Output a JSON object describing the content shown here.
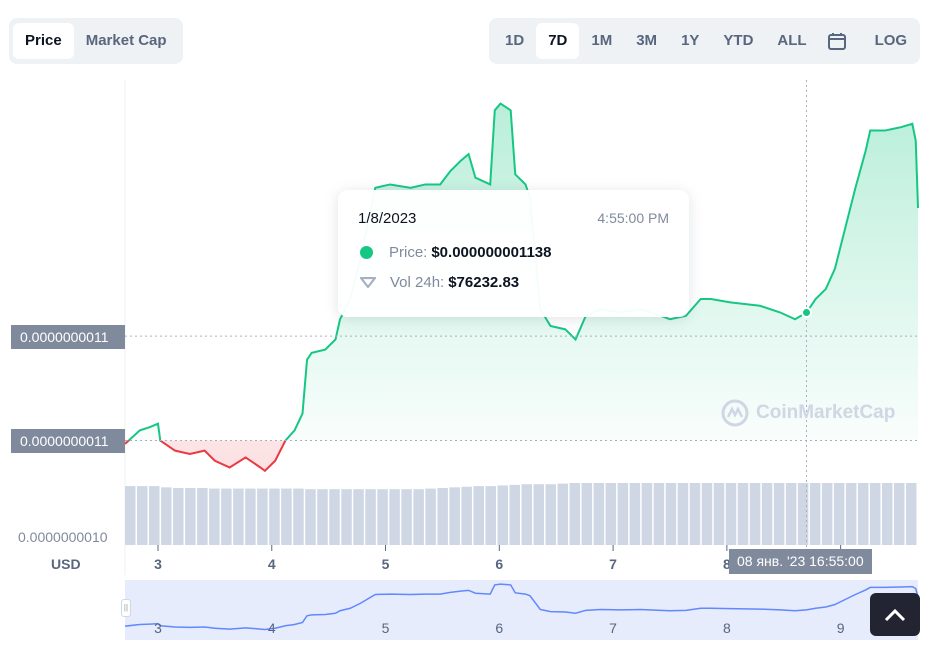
{
  "toggle": {
    "items": [
      {
        "label": "Price",
        "active": true
      },
      {
        "label": "Market Cap",
        "active": false
      }
    ]
  },
  "ranges": {
    "items": [
      {
        "label": "1D"
      },
      {
        "label": "7D",
        "active": true
      },
      {
        "label": "1M"
      },
      {
        "label": "3M"
      },
      {
        "label": "1Y"
      },
      {
        "label": "YTD"
      },
      {
        "label": "ALL"
      }
    ],
    "calendar_icon": "calendar-icon",
    "log_label": "LOG"
  },
  "colors": {
    "up": "#16c784",
    "down": "#ea3943",
    "volume": "#cfd6e4",
    "label_bg": "#808a9d"
  },
  "tooltip": {
    "date": "1/8/2023",
    "time": "4:55:00 PM",
    "price_label": "Price:",
    "price_value": "$0.000000001138",
    "vol_label": "Vol 24h:",
    "vol_value": "$76232.83"
  },
  "crosshair": {
    "label": "08 янв. '23   16:55:00"
  },
  "watermark": "CoinMarketCap",
  "chart_data": {
    "type": "line",
    "xlabel": "",
    "ylabel": "USD",
    "currency_label": "USD",
    "x_ticks": [
      "3",
      "4",
      "5",
      "6",
      "7",
      "8",
      "9"
    ],
    "y_labels": [
      {
        "value": 1.131e-09,
        "label": "0.0000000011"
      },
      {
        "value": 1.1e-09,
        "label": "0.0000000011"
      },
      {
        "value": 1e-09,
        "label": "0.0000000010"
      }
    ],
    "xlim": [
      2.71,
      9.68
    ],
    "ylim": [
      1.069e-09,
      1.207e-09
    ],
    "baseline": 1.1e-09,
    "selected": {
      "x": 8.7,
      "y": 1.138e-09
    },
    "series": [
      {
        "x": [
          2.71,
          2.84,
          2.93,
          3.0,
          3.02,
          3.15,
          3.28,
          3.41,
          3.5,
          3.63,
          3.77,
          3.9,
          3.94,
          4.03,
          4.12,
          4.2,
          4.27,
          4.31,
          4.35,
          4.47,
          4.56,
          4.6,
          4.69,
          4.78,
          4.91,
          5.04,
          5.22,
          5.35,
          5.48,
          5.57,
          5.66,
          5.73,
          5.79,
          5.92,
          5.96,
          6.01,
          6.1,
          6.14,
          6.23,
          6.27,
          6.36,
          6.45,
          6.58,
          6.67,
          6.76,
          6.89,
          7.06,
          7.24,
          7.42,
          7.5,
          7.64,
          7.77,
          7.86,
          8.03,
          8.29,
          8.47,
          8.6,
          8.7,
          8.78,
          8.87,
          8.95,
          9.04,
          9.13,
          9.22,
          9.26,
          9.39,
          9.53,
          9.63,
          9.66,
          9.68
        ],
        "y": [
          1.099e-09,
          1.103e-09,
          1.104e-09,
          1.105e-09,
          1.1e-09,
          1.097e-09,
          1.096e-09,
          1.097e-09,
          1.094e-09,
          1.092e-09,
          1.095e-09,
          1.092e-09,
          1.091e-09,
          1.094e-09,
          1.1e-09,
          1.103e-09,
          1.108e-09,
          1.124e-09,
          1.126e-09,
          1.127e-09,
          1.13e-09,
          1.136e-09,
          1.142e-09,
          1.154e-09,
          1.175e-09,
          1.176e-09,
          1.175e-09,
          1.176e-09,
          1.176e-09,
          1.18e-09,
          1.183e-09,
          1.185e-09,
          1.178e-09,
          1.176e-09,
          1.198e-09,
          1.2e-09,
          1.198e-09,
          1.179e-09,
          1.176e-09,
          1.172e-09,
          1.139e-09,
          1.134e-09,
          1.133e-09,
          1.13e-09,
          1.137e-09,
          1.139e-09,
          1.138e-09,
          1.139e-09,
          1.137e-09,
          1.136e-09,
          1.137e-09,
          1.142e-09,
          1.142e-09,
          1.141e-09,
          1.14e-09,
          1.138e-09,
          1.136e-09,
          1.138e-09,
          1.142e-09,
          1.145e-09,
          1.151e-09,
          1.163e-09,
          1.175e-09,
          1.186e-09,
          1.192e-09,
          1.192e-09,
          1.193e-09,
          1.194e-09,
          1.189e-09,
          1.169e-09
        ]
      }
    ],
    "volume_relative": [
      0.95,
      0.95,
      0.95,
      0.93,
      0.92,
      0.92,
      0.92,
      0.91,
      0.91,
      0.91,
      0.91,
      0.91,
      0.91,
      0.91,
      0.91,
      0.9,
      0.9,
      0.9,
      0.9,
      0.9,
      0.9,
      0.9,
      0.9,
      0.9,
      0.9,
      0.91,
      0.92,
      0.93,
      0.94,
      0.95,
      0.95,
      0.96,
      0.97,
      0.98,
      0.98,
      0.98,
      0.99,
      1,
      1,
      1,
      1,
      1,
      1,
      1,
      1,
      1,
      1,
      1,
      1,
      1,
      1,
      1,
      1,
      1,
      1,
      1,
      1,
      1,
      1,
      1,
      1,
      1,
      1,
      1,
      1,
      1
    ]
  },
  "navigator": {
    "x_ticks": [
      "3",
      "4",
      "5",
      "6",
      "7",
      "8",
      "9"
    ]
  },
  "scroll_top_icon": "chevron-up-icon"
}
